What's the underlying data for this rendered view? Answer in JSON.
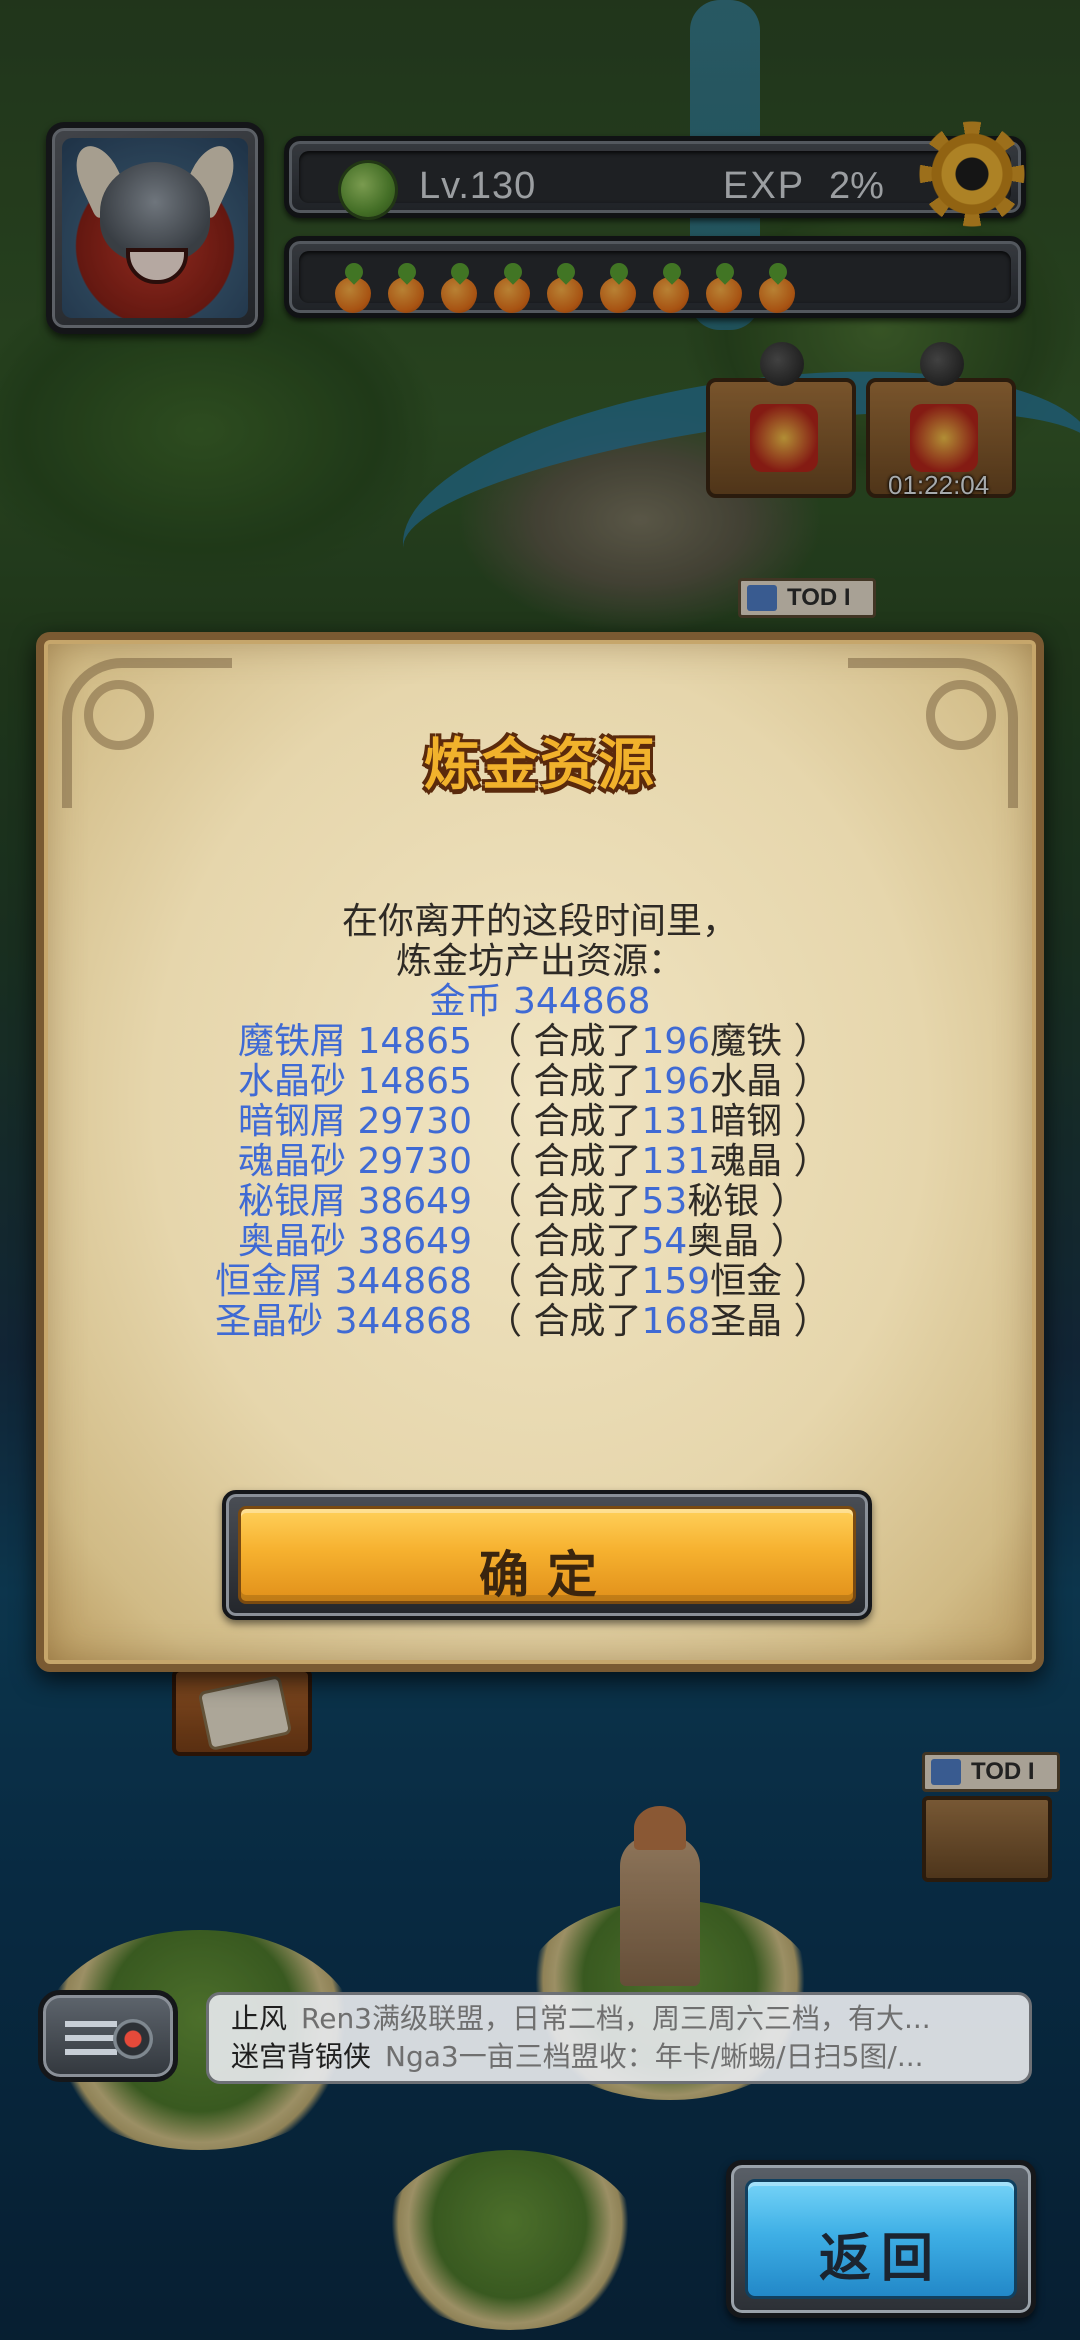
{
  "hud": {
    "level": "Lv.130",
    "exp_label": "EXP",
    "exp_value": "2%",
    "stamina_count": 9,
    "timer": "01:22:04"
  },
  "map_signs": {
    "tod_label_1": "TOD I",
    "tod_label_2": "TOD I"
  },
  "dialog": {
    "title": "炼金资源",
    "message_line1": "在你离开的这段时间里，",
    "message_line2": "炼金坊产出资源：",
    "gold_label": "金币",
    "gold_amount": "344868",
    "resources": [
      {
        "name": "魔铁屑",
        "amount": "14865",
        "crafted_count": "196",
        "crafted_item": "魔铁"
      },
      {
        "name": "水晶砂",
        "amount": "14865",
        "crafted_count": "196",
        "crafted_item": "水晶"
      },
      {
        "name": "暗钢屑",
        "amount": "29730",
        "crafted_count": "131",
        "crafted_item": "暗钢"
      },
      {
        "name": "魂晶砂",
        "amount": "29730",
        "crafted_count": "131",
        "crafted_item": "魂晶"
      },
      {
        "name": "秘银屑",
        "amount": "38649",
        "crafted_count": "53",
        "crafted_item": "秘银"
      },
      {
        "name": "奥晶砂",
        "amount": "38649",
        "crafted_count": "54",
        "crafted_item": "奥晶"
      },
      {
        "name": "恒金屑",
        "amount": "344868",
        "crafted_count": "159",
        "crafted_item": "恒金"
      },
      {
        "name": "圣晶砂",
        "amount": "344868",
        "crafted_count": "168",
        "crafted_item": "圣晶"
      }
    ],
    "paren_prefix": "（ 合成了",
    "paren_suffix": "）",
    "confirm_label": "确定"
  },
  "chat": {
    "messages": [
      {
        "sender": "止风",
        "text": "Ren3满级联盟，日常二档，周三周六三档，有大..."
      },
      {
        "sender": "迷宫背锅侠",
        "text": "Nga3一亩三档盟收：年卡/蜥蜴/日扫5图/..."
      }
    ]
  },
  "back_label": "返回",
  "icons": {
    "settings": "gear-icon",
    "level": "leaf-icon",
    "stamina": "carrot-icon",
    "chat": "radio-icon"
  },
  "colors": {
    "resource_blue": "#3f6ad4",
    "title_gold": "#f1b22c",
    "confirm_yellow": "#f6b12f",
    "back_blue": "#3fb0e6"
  }
}
